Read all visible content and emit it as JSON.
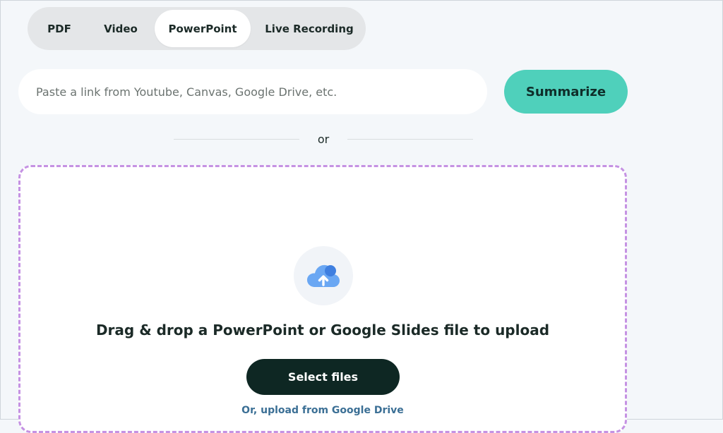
{
  "tabs": [
    {
      "label": "PDF",
      "active": false
    },
    {
      "label": "Video",
      "active": false
    },
    {
      "label": "PowerPoint",
      "active": true
    },
    {
      "label": "Live Recording",
      "active": false
    }
  ],
  "link_form": {
    "placeholder": "Paste a link from Youtube, Canvas, Google Drive, etc.",
    "value": "",
    "submit_label": "Summarize"
  },
  "divider": {
    "text": "or"
  },
  "upload": {
    "icon": "cloud-upload-icon",
    "title": "Drag & drop a PowerPoint or Google Slides file to upload",
    "select_label": "Select files",
    "drive_link": "Or, upload from Google Drive"
  },
  "colors": {
    "accent": "#4fd0bb",
    "dark_button": "#0e2723",
    "dropzone_border": "#c592e3",
    "link_color": "#3b6f95",
    "icon_blue": "#5b9ff0"
  }
}
